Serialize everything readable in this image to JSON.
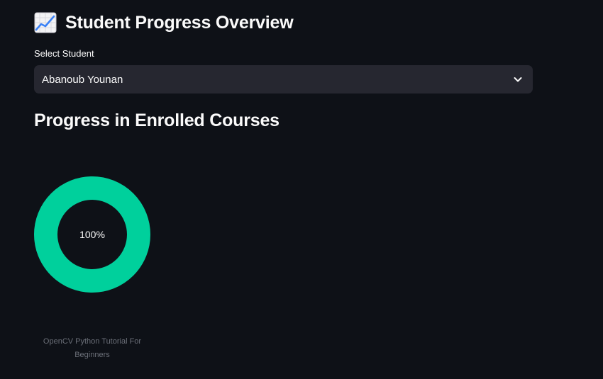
{
  "header": {
    "title": "Student Progress Overview",
    "icon": "chart-increasing-icon"
  },
  "student_select": {
    "label": "Select Student",
    "selected": "Abanoub Younan"
  },
  "section": {
    "title": "Progress in Enrolled Courses"
  },
  "courses": [
    {
      "name": "OpenCV Python Tutorial For Beginners",
      "progress_label": "100%",
      "progress": 1.0
    }
  ],
  "colors": {
    "background": "#0e1117",
    "select_bg": "#262730",
    "progress": "#00d09c",
    "caption": "#6b6f78"
  }
}
